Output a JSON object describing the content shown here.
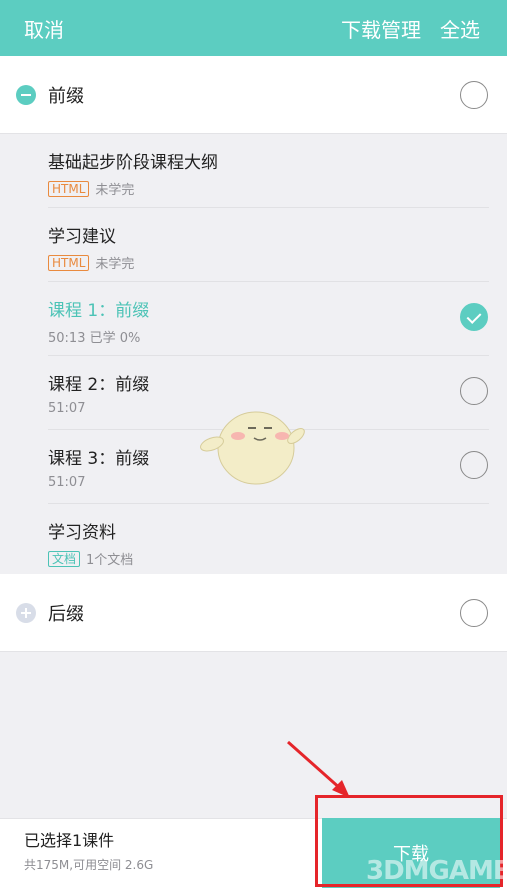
{
  "header": {
    "cancel_label": "取消",
    "manage_label": "下载管理",
    "select_all_label": "全选"
  },
  "chapters": [
    {
      "title": "前缀",
      "expanded": true,
      "checked": false,
      "lessons": [
        {
          "name": "基础起步阶段课程大纲",
          "tag": "HTML",
          "meta": "未学完",
          "checked": null
        },
        {
          "name": "学习建议",
          "tag": "HTML",
          "meta": "未学完",
          "checked": null
        },
        {
          "name": "课程 1：前缀",
          "tag": "",
          "meta": "50:13  已学 0%",
          "checked": true
        },
        {
          "name": "课程 2：前缀",
          "tag": "",
          "meta": "51:07",
          "checked": false
        },
        {
          "name": "课程 3：前缀",
          "tag": "",
          "meta": "51:07",
          "checked": false
        },
        {
          "name": "学习资料",
          "tag": "文档",
          "meta": "1个文档",
          "checked": null
        }
      ]
    },
    {
      "title": "后缀",
      "expanded": false,
      "checked": false,
      "lessons": []
    }
  ],
  "footer": {
    "selected_text": "已选择1课件",
    "space_text": "共175M,可用空间 2.6G",
    "download_label": "下载"
  },
  "watermark": "3DMGAME",
  "colors": {
    "accent": "#5ccdc1",
    "html_tag": "#e98a3e",
    "annotation": "#e5252a"
  }
}
